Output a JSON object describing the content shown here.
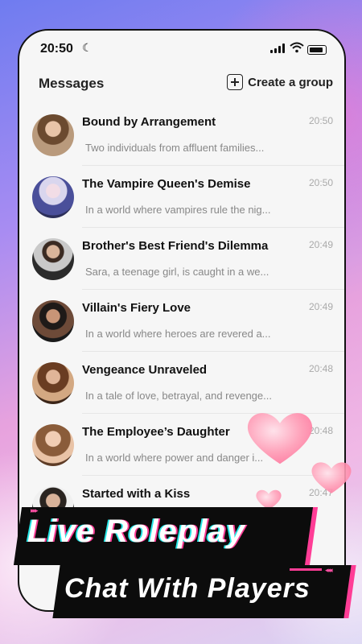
{
  "status_bar": {
    "time": "20:50",
    "moon_icon": "☾"
  },
  "header": {
    "title": "Messages",
    "create_label": "Create a group"
  },
  "chats": [
    {
      "name": "Bound by Arrangement",
      "time": "20:50",
      "preview": "Two individuals from affluent families..."
    },
    {
      "name": "The Vampire Queen's Demise",
      "time": "20:50",
      "preview": "In a world where vampires rule the nig..."
    },
    {
      "name": "Brother's Best Friend's Dilemma",
      "time": "20:49",
      "preview": "Sara, a teenage girl, is caught in a we..."
    },
    {
      "name": "Villain's Fiery Love",
      "time": "20:49",
      "preview": "In a world where heroes are revered a..."
    },
    {
      "name": "Vengeance Unraveled",
      "time": "20:48",
      "preview": "In a tale of love, betrayal, and revenge..."
    },
    {
      "name": "The Employee’s Daughter",
      "time": "20:48",
      "preview": "In a world where power and danger i..."
    },
    {
      "name": "Started with a Kiss",
      "time": "20:47",
      "preview": ""
    }
  ],
  "promo": {
    "line1": "Live Roleplay",
    "line2": "Chat With Players",
    "arrows": "▸▸▸",
    "arrows_left": "◂◂◂"
  },
  "colors": {
    "accent_pink": "#ff3d96",
    "accent_cyan": "#27e6e6"
  }
}
